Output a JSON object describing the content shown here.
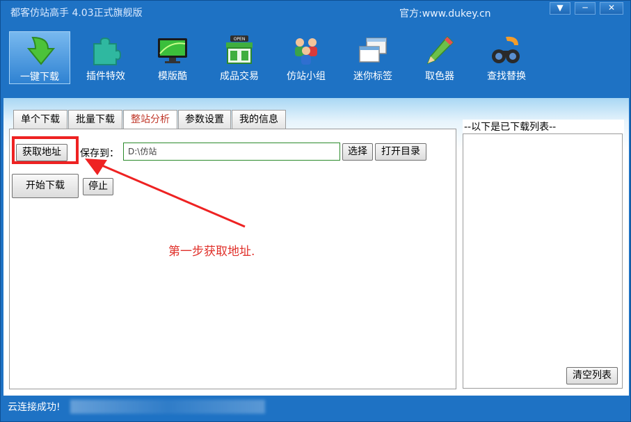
{
  "window": {
    "title": "都客仿站高手 4.03正式旗舰版",
    "official_site": "官方:www.dukey.cn",
    "controls": {
      "menu": "▼",
      "minimize": "─",
      "close": "✕"
    }
  },
  "toolbar": [
    {
      "label": "一键下载",
      "icon": "green-down-arrow-icon",
      "active": true
    },
    {
      "label": "插件特效",
      "icon": "puzzle-piece-icon"
    },
    {
      "label": "模版酷",
      "icon": "monitor-icon"
    },
    {
      "label": "成品交易",
      "icon": "open-store-icon"
    },
    {
      "label": "仿站小组",
      "icon": "people-group-icon"
    },
    {
      "label": "迷你标签",
      "icon": "windows-tabs-icon"
    },
    {
      "label": "取色器",
      "icon": "pencil-icon"
    },
    {
      "label": "查找替换",
      "icon": "binoculars-icon"
    }
  ],
  "tabs": [
    {
      "label": "单个下载"
    },
    {
      "label": "批量下载"
    },
    {
      "label": "整站分析",
      "active": true
    },
    {
      "label": "参数设置"
    },
    {
      "label": "我的信息"
    }
  ],
  "panel": {
    "get_address_button": "获取地址",
    "save_to_label": "保存到：",
    "save_path": "D:\\仿站",
    "select_button": "选择",
    "open_dir_button": "打开目录",
    "start_download_button": "开始下载",
    "stop_button": "停止",
    "annotation": "第一步获取地址."
  },
  "download_list": {
    "title": "--以下是已下载列表--",
    "clear_button": "清空列表"
  },
  "status": {
    "text": "云连接成功!"
  },
  "colors": {
    "chrome_blue": "#1e72c4",
    "annotation_red": "#e0302a",
    "active_tab_text": "#c0392b"
  }
}
